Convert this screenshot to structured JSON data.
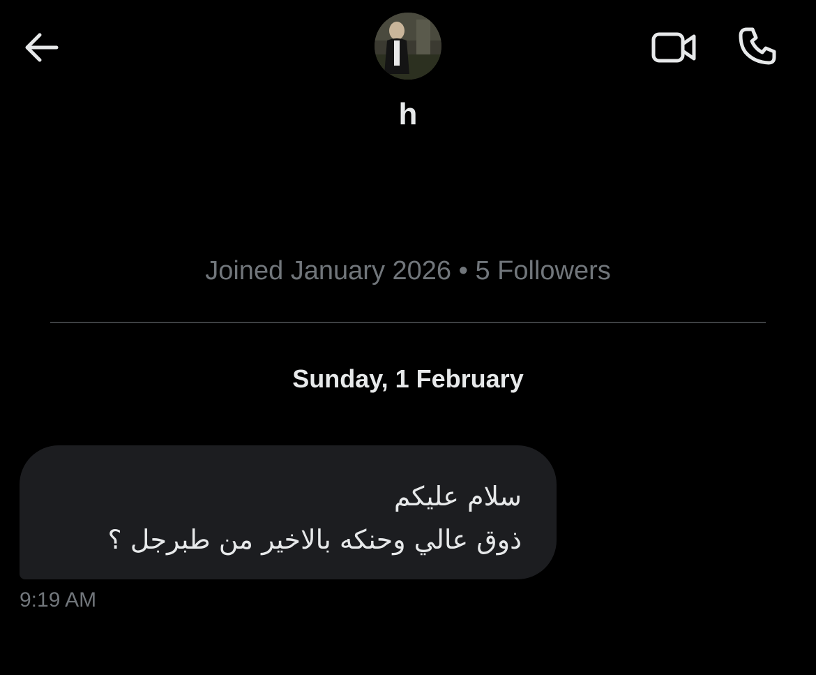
{
  "header": {
    "name": "h",
    "back_icon": "arrow-left-icon",
    "video_icon": "video-camera-icon",
    "call_icon": "phone-icon"
  },
  "profile": {
    "joined_text": "Joined January 2026 • 5 Followers"
  },
  "conversation": {
    "date_separator": "Sunday, 1 February",
    "messages": [
      {
        "lines": [
          "سلام عليكم",
          "ذوق عالي وحنكه بالاخير من طبرجل ؟"
        ],
        "time": "9:19 AM",
        "direction": "incoming"
      }
    ]
  },
  "colors": {
    "background": "#000000",
    "primary_text": "#e7e9ea",
    "secondary_text": "#71767b",
    "bubble": "#1c1d20",
    "divider": "#3d4043"
  }
}
